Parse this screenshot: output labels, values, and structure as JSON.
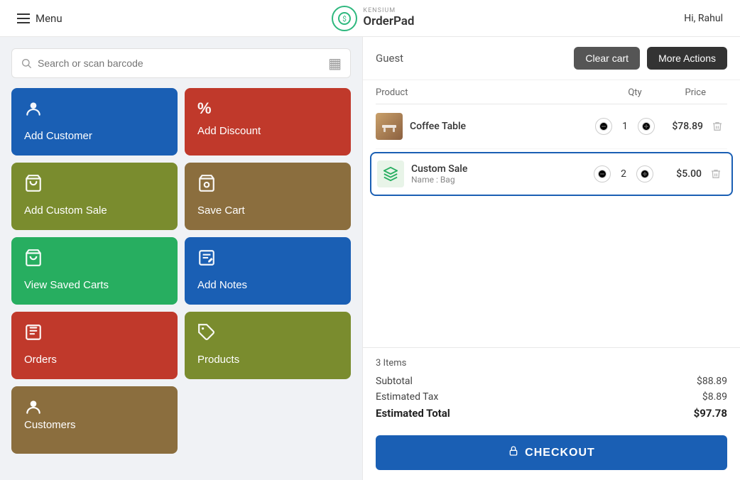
{
  "header": {
    "menu_label": "Menu",
    "logo_kensium": "KENSIUM",
    "logo_orderpad": "OrderPad",
    "user_greeting": "Hi, Rahul"
  },
  "search": {
    "placeholder": "Search or scan barcode"
  },
  "action_buttons": [
    {
      "id": "add-customer",
      "label": "Add Customer",
      "icon": "👤",
      "color": "btn-blue"
    },
    {
      "id": "add-discount",
      "label": "Add Discount",
      "icon": "%",
      "color": "btn-red"
    },
    {
      "id": "add-custom-sale",
      "label": "Add Custom Sale",
      "icon": "🛒",
      "color": "btn-olive"
    },
    {
      "id": "save-cart",
      "label": "Save Cart",
      "icon": "🛒",
      "color": "btn-brown"
    },
    {
      "id": "view-saved-carts",
      "label": "View Saved Carts",
      "icon": "🛒",
      "color": "btn-green"
    },
    {
      "id": "add-notes",
      "label": "Add Notes",
      "icon": "✏",
      "color": "btn-blue2"
    },
    {
      "id": "orders",
      "label": "Orders",
      "icon": "🛍",
      "color": "btn-red2"
    },
    {
      "id": "products",
      "label": "Products",
      "icon": "🏷",
      "color": "btn-olive2"
    },
    {
      "id": "customers",
      "label": "Customers",
      "icon": "👤",
      "color": "btn-brown2"
    }
  ],
  "cart": {
    "guest_label": "Guest",
    "clear_cart_label": "Clear cart",
    "more_actions_label": "More Actions",
    "columns": {
      "product": "Product",
      "qty": "Qty",
      "price": "Price"
    },
    "items": [
      {
        "id": "coffee-table",
        "name": "Coffee Table",
        "sub": "",
        "qty": 1,
        "price": "$78.89",
        "highlighted": false,
        "type": "product"
      },
      {
        "id": "custom-sale",
        "name": "Custom Sale",
        "sub": "Name : Bag",
        "qty": 2,
        "price": "$5.00",
        "highlighted": true,
        "type": "custom"
      }
    ],
    "items_count": "3 Items",
    "subtotal_label": "Subtotal",
    "subtotal_value": "$88.89",
    "tax_label": "Estimated Tax",
    "tax_value": "$8.89",
    "total_label": "Estimated Total",
    "total_value": "$97.78",
    "checkout_label": "CHECKOUT"
  }
}
